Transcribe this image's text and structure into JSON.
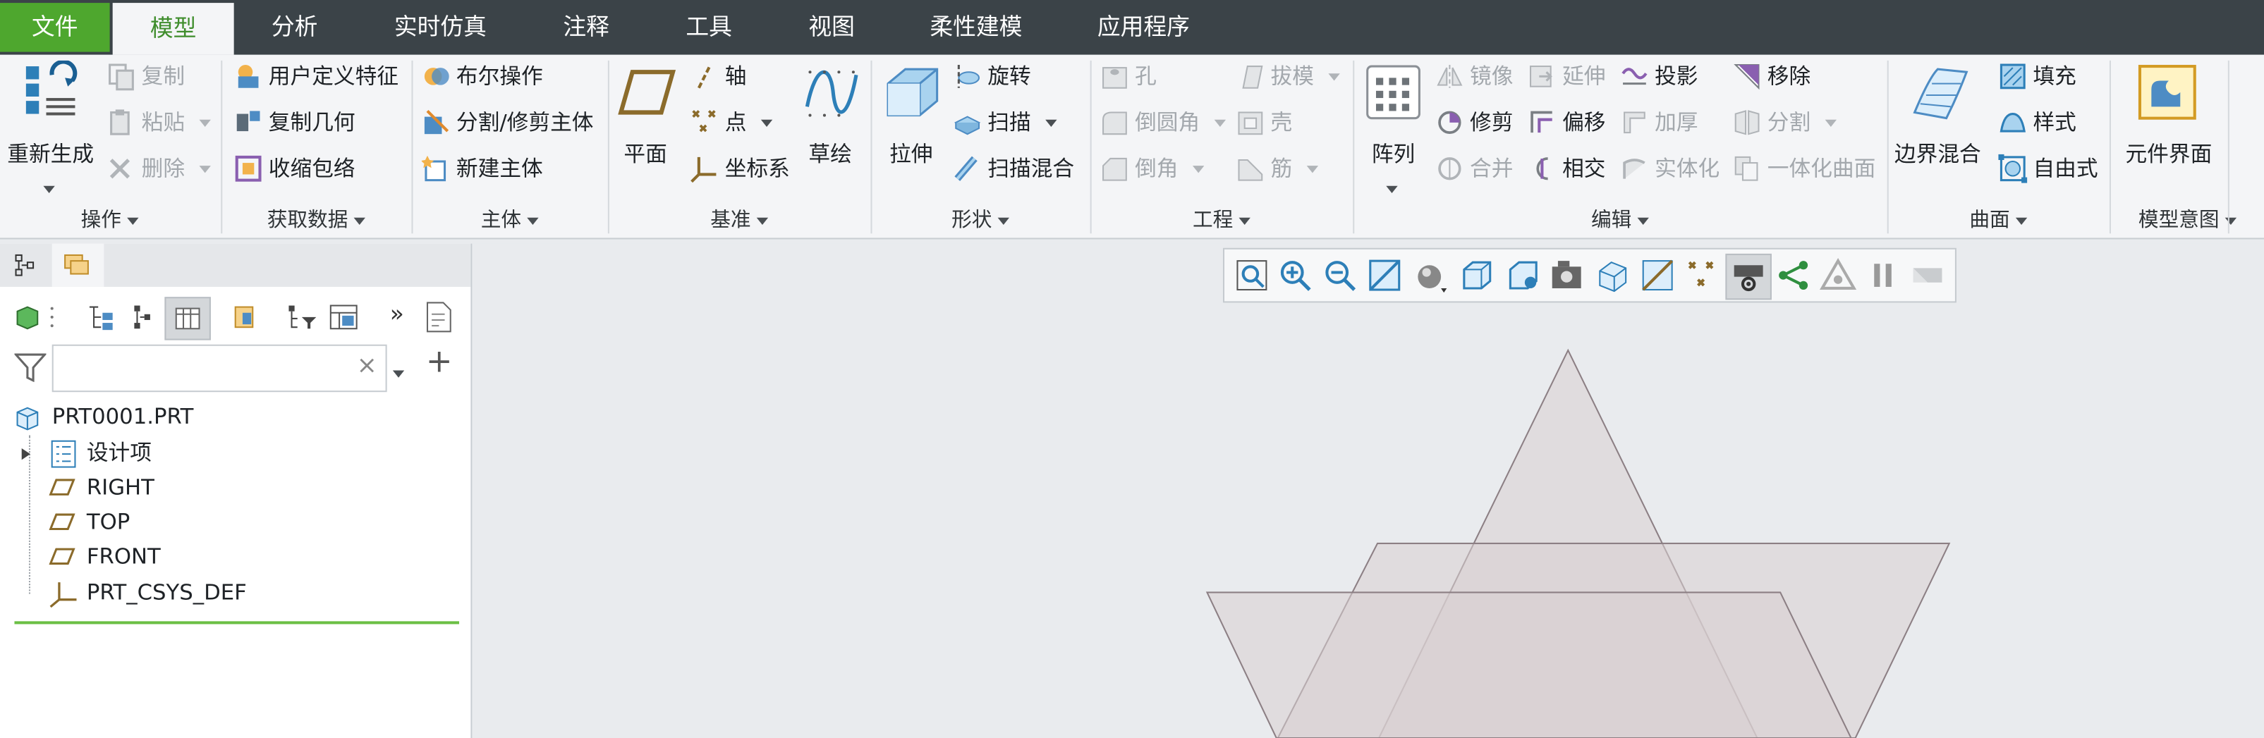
{
  "tabs": {
    "file": "文件",
    "model": "模型",
    "analysis": "分析",
    "simulate": "实时仿真",
    "annotate": "注释",
    "tools": "工具",
    "view": "视图",
    "flexible": "柔性建模",
    "apps": "应用程序"
  },
  "groups": {
    "operations": {
      "label": "操作",
      "regenerate": "重新生成",
      "copy": "复制",
      "paste": "粘贴",
      "delete": "删除"
    },
    "getdata": {
      "label": "获取数据",
      "udf": "用户定义特征",
      "copygeom": "复制几何",
      "shrinkwrap": "收缩包络"
    },
    "body": {
      "label": "主体",
      "boolean": "布尔操作",
      "split": "分割/修剪主体",
      "newbody": "新建主体"
    },
    "datum": {
      "label": "基准",
      "plane": "平面",
      "axis": "轴",
      "point": "点",
      "csys": "坐标系",
      "sketch": "草绘"
    },
    "shapes": {
      "label": "形状",
      "extrude": "拉伸",
      "revolve": "旋转",
      "sweep": "扫描",
      "sweptblend": "扫描混合"
    },
    "engineering": {
      "label": "工程",
      "hole": "孔",
      "round": "倒圆角",
      "chamfer": "倒角",
      "draft": "拔模",
      "shell": "壳",
      "rib": "筋"
    },
    "editing": {
      "label": "编辑",
      "pattern": "阵列",
      "mirror": "镜像",
      "trim": "修剪",
      "merge": "合并",
      "extend": "延伸",
      "offset": "偏移",
      "intersect": "相交",
      "project": "投影",
      "thicken": "加厚",
      "solidify": "实体化",
      "remove": "移除",
      "split": "分割",
      "unify": "一体化曲面"
    },
    "surfaces": {
      "label": "曲面",
      "boundary": "边界混合",
      "fill": "填充",
      "style": "样式",
      "freestyle": "自由式"
    },
    "intent": {
      "label": "模型意图",
      "component": "元件界面"
    }
  },
  "tree": {
    "root": "PRT0001.PRT",
    "items": [
      "设计项",
      "RIGHT",
      "TOP",
      "FRONT",
      "PRT_CSYS_DEF"
    ]
  },
  "search": {
    "value": "",
    "clear": "×"
  },
  "colors": {
    "tabbar": "#3b4348",
    "file_tab": "#4ea72e",
    "active_tab_text": "#3f8d2c",
    "ribbon": "#f4f5f7",
    "viewport": "#e9ebee"
  }
}
